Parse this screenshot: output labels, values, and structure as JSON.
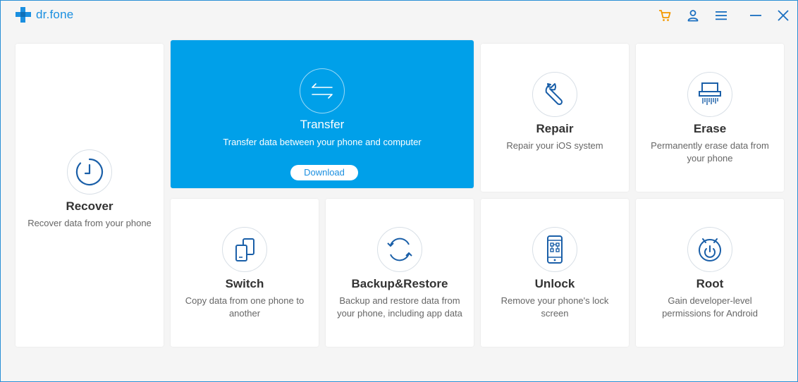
{
  "app": {
    "name": "dr.fone",
    "brand_color": "#1a8fe0",
    "accent_color": "#00a0e9"
  },
  "titlebar": {
    "icons": [
      "cart-icon",
      "user-icon",
      "menu-icon",
      "minimize-icon",
      "close-icon"
    ]
  },
  "cards": {
    "recover": {
      "title": "Recover",
      "desc": "Recover data from your phone",
      "icon": "clock-icon"
    },
    "transfer": {
      "title": "Transfer",
      "desc": "Transfer data between your phone and computer",
      "button": "Download",
      "icon": "transfer-arrows-icon"
    },
    "repair": {
      "title": "Repair",
      "desc": "Repair your iOS system",
      "icon": "wrench-icon"
    },
    "erase": {
      "title": "Erase",
      "desc": "Permanently erase data from your phone",
      "icon": "shredder-icon"
    },
    "switch": {
      "title": "Switch",
      "desc": "Copy data from one phone to another",
      "icon": "switch-phones-icon"
    },
    "backup": {
      "title": "Backup&Restore",
      "desc": "Backup and restore data from your phone, including app data",
      "icon": "sync-icon"
    },
    "unlock": {
      "title": "Unlock",
      "desc": "Remove your phone's lock screen",
      "icon": "phone-lock-icon"
    },
    "root": {
      "title": "Root",
      "desc": "Gain developer-level permissions for Android",
      "icon": "android-power-icon"
    }
  }
}
